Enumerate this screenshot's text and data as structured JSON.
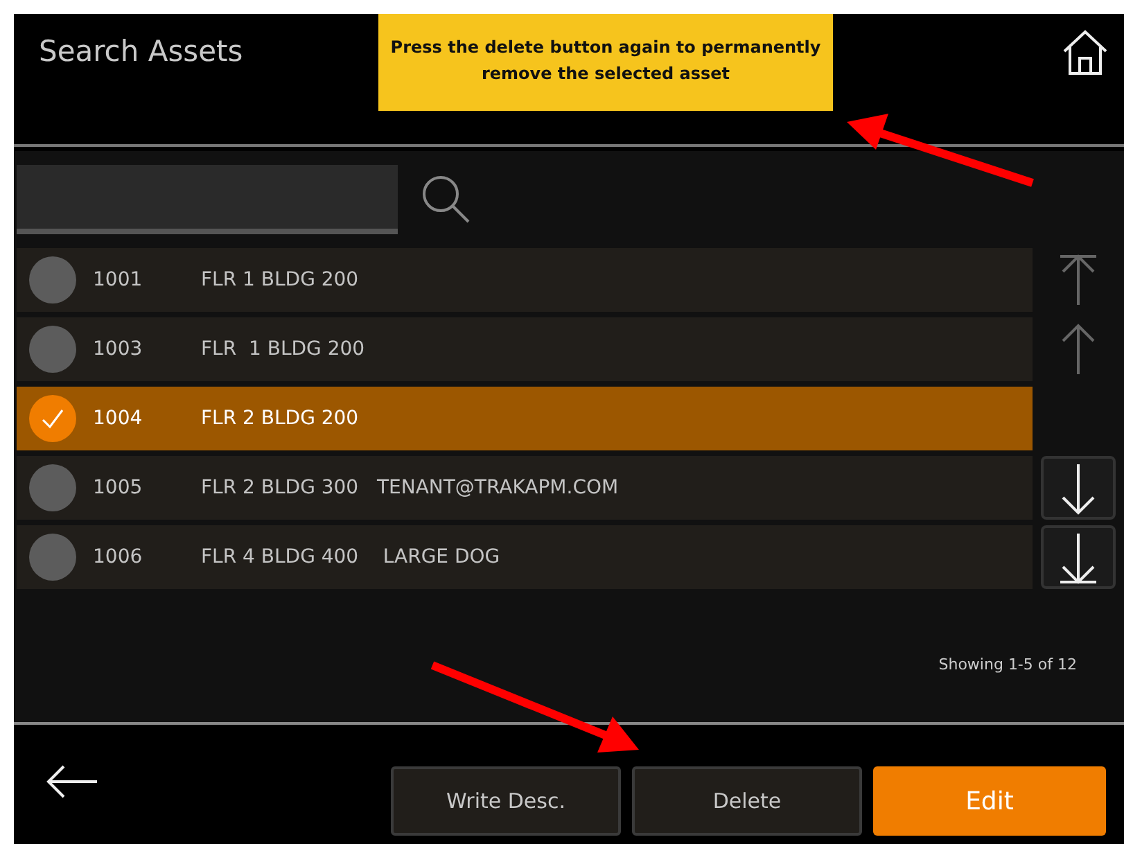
{
  "header": {
    "title": "Search Assets",
    "notice": "Press the delete button again to permanently remove the selected asset"
  },
  "assets": [
    {
      "id": "1001",
      "description": "FLR 1 BLDG 200",
      "selected": false
    },
    {
      "id": "1003",
      "description": "FLR  1 BLDG 200",
      "selected": false
    },
    {
      "id": "1004",
      "description": "FLR 2 BLDG 200",
      "selected": true
    },
    {
      "id": "1005",
      "description": "FLR 2 BLDG 300   TENANT@TRAKAPM.COM",
      "selected": false
    },
    {
      "id": "1006",
      "description": "FLR 4 BLDG 400    LARGE DOG",
      "selected": false
    }
  ],
  "scroll_buttons": [
    {
      "kind": "top",
      "disabled": true
    },
    {
      "kind": "up",
      "disabled": true
    },
    {
      "kind": "down",
      "disabled": false
    },
    {
      "kind": "bottom",
      "disabled": false
    }
  ],
  "paging": "Showing 1-5 of 12",
  "buttons": [
    {
      "label": "Write Desc.",
      "kind": "secondary"
    },
    {
      "label": "Delete",
      "kind": "secondary"
    },
    {
      "label": "Edit",
      "kind": "primary"
    }
  ]
}
